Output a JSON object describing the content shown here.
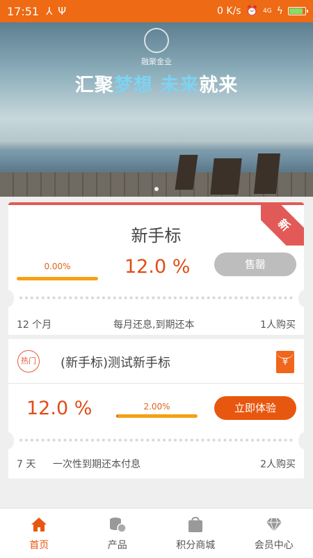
{
  "status_bar": {
    "time": "17:51",
    "speed": "0 K/s",
    "network": "4G"
  },
  "banner": {
    "logo_text": "融聚金业",
    "slogan_part1": "汇聚",
    "slogan_part2": "梦想",
    "slogan_part3": " 未来",
    "slogan_part4": "就来"
  },
  "card_new": {
    "title": "新手标",
    "ribbon": "新",
    "progress_percent": "0.00%",
    "progress": 0.0,
    "rate": "12.0 %",
    "button": "售罄",
    "term": "12 个月",
    "repayment": "每月还息,到期还本",
    "buyers": "1人购买"
  },
  "card_product": {
    "hot_badge": "热门",
    "name": "(新手标)测试新手标",
    "rate": "12.0 %",
    "progress_percent": "2.00%",
    "progress": 0.02,
    "button": "立即体验",
    "term": "7 天",
    "repayment": "一次性到期还本付息",
    "buyers": "2人购买"
  },
  "tabbar": {
    "items": [
      {
        "label": "首页",
        "icon": "home-icon",
        "active": true
      },
      {
        "label": "产品",
        "icon": "coins-icon",
        "active": false
      },
      {
        "label": "积分商城",
        "icon": "shopping-bag-icon",
        "active": false
      },
      {
        "label": "会员中心",
        "icon": "diamond-icon",
        "active": false
      }
    ]
  },
  "colors": {
    "brand_orange": "#ee6a14",
    "accent_red": "#e25a57",
    "progress_yellow": "#f5a113"
  }
}
